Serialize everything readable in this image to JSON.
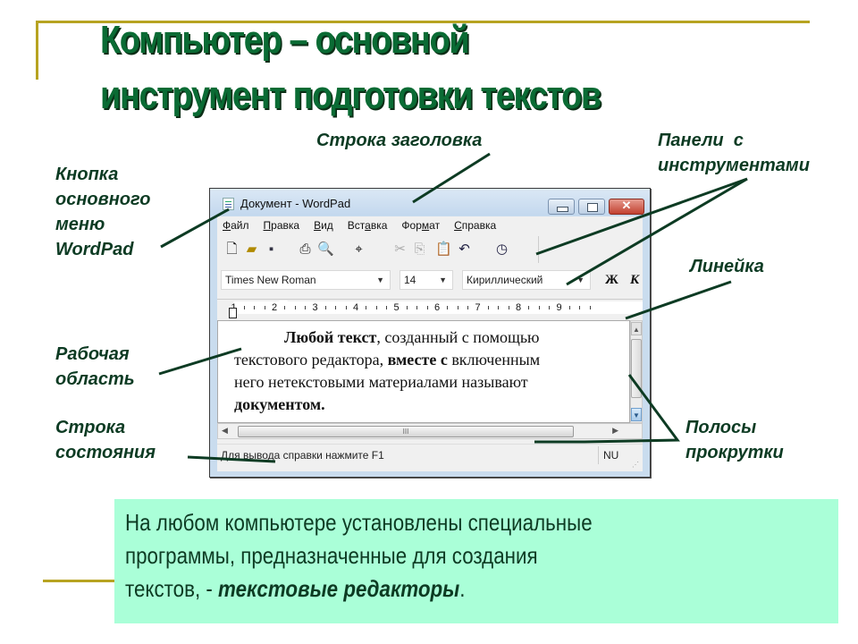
{
  "slide": {
    "title_lines": [
      "Компьютер – основной",
      "инструмент подготовки текстов"
    ],
    "accent_color": "#b7a321",
    "title_color": "#0a6b34"
  },
  "labels": {
    "title_bar": "Строка заголовка",
    "toolbars_line1": "Панели  с",
    "toolbars_line2": "инструментами",
    "menu_button_line1": "Кнопка",
    "menu_button_line2": "основного",
    "menu_button_line3": "меню",
    "menu_button_line4": "WordPad",
    "ruler": "Линейка",
    "work_area_line1": "Рабочая",
    "work_area_line2": "область",
    "status_bar_line1": "Строка",
    "status_bar_line2": "состояния",
    "scrollbars_line1": "Полосы",
    "scrollbars_line2": "прокрутки"
  },
  "wordpad": {
    "window_title": "Документ - WordPad",
    "menu": [
      {
        "accel": "Ф",
        "rest": "айл"
      },
      {
        "accel": "П",
        "rest": "равка"
      },
      {
        "accel": "В",
        "rest": "ид"
      },
      {
        "pre": "Вст",
        "accel": "а",
        "rest": "вка"
      },
      {
        "pre": "Фор",
        "accel": "м",
        "rest": "ат"
      },
      {
        "accel": "С",
        "rest": "правка"
      }
    ],
    "menu_labels": [
      "Файл",
      "Правка",
      "Вид",
      "Вставка",
      "Формат",
      "Справка"
    ],
    "toolbar_icons": [
      "new-icon",
      "open-icon",
      "save-icon",
      "print-icon",
      "print-preview-icon",
      "find-icon",
      "cut-icon",
      "copy-icon",
      "paste-icon",
      "undo-icon",
      "insert-datetime-icon"
    ],
    "font_name": "Times New Roman",
    "font_size": "14",
    "script": "Кириллический",
    "bold_button": "Ж",
    "italic_button": "К",
    "ruler_numbers": [
      "1",
      "2",
      "3",
      "4",
      "5",
      "6",
      "7",
      "8",
      "9"
    ],
    "document_text": {
      "line1_bold": "Любой текст",
      "line1_rest": ", созданный с помощью",
      "line2_a": "текстового редактора, ",
      "line2_bold": "вместе с",
      "line2_b": " включенным",
      "line3": "него нетекстовыми материалами называют",
      "line4_bold": "документом."
    },
    "status_text": "Для вывода справки нажмите F1",
    "status_indicator": "NU",
    "scroll_thumb_glyph": "III"
  },
  "note": {
    "line1": "На любом компьютере установлены специальные",
    "line2": "программы, предназначенные для создания",
    "line3_prefix": "текстов, - ",
    "line3_emph": "текстовые редакторы",
    "line3_suffix": "."
  }
}
